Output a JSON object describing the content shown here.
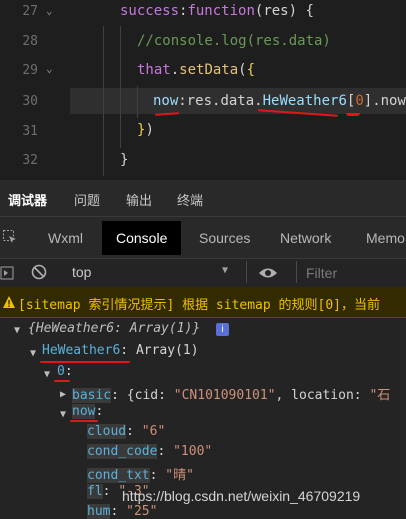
{
  "editor": {
    "line_numbers": [
      "27",
      "28",
      "29",
      "30",
      "31",
      "32"
    ],
    "line27": {
      "kw": "success",
      "colon": ":",
      "fn": "function",
      "rest": "(res) {"
    },
    "line28": {
      "comment": "//console.log(res.data)"
    },
    "line29": {
      "kw": "that",
      "dot": ".",
      "fn": "setData",
      "paren": "(",
      "brace": "{"
    },
    "line30": {
      "key": "now",
      "colon": ":",
      "res": "res.data.",
      "he": "HeWeather6",
      "lb": "[",
      "idx": "0",
      "rb": "]",
      "tail": ".now"
    },
    "line31": {
      "brace": "}",
      "paren": ")"
    },
    "line32": {
      "brace": "}"
    }
  },
  "devtools": {
    "top_tabs": [
      "调试器",
      "问题",
      "输出",
      "终端"
    ],
    "panel_tabs": [
      "Wxml",
      "Console",
      "Sources",
      "Network",
      "Memo"
    ],
    "active_panel": "Console",
    "context_select": "top",
    "filter_placeholder": "Filter",
    "warning_text": "[sitemap 索引情况提示] 根据 sitemap 的规则[0]，当前",
    "console": {
      "root": "{HeWeather6: Array(1)}",
      "info_badge": "i",
      "he_key": "HeWeather6",
      "he_val": "Array(1)",
      "idx": "0",
      "basic_key": "basic",
      "basic_val": "{cid: ",
      "basic_cid": "\"CN101090101\"",
      "basic_rest": ", location: ",
      "basic_loc": "\"石",
      "now_key": "now",
      "props": [
        {
          "k": "cloud",
          "v": "\"6\""
        },
        {
          "k": "cond_code",
          "v": "\"100\""
        },
        {
          "k": "cond_txt",
          "v": "\"晴\""
        },
        {
          "k": "fl",
          "v": "\"-3\""
        },
        {
          "k": "hum",
          "v": "\"25\""
        }
      ]
    }
  },
  "watermark": "https://blog.csdn.net/weixin_46709219",
  "colors": {
    "accent_underline": "#e0171a",
    "warning_bg": "#332b00",
    "warning_text": "#f0c000"
  }
}
